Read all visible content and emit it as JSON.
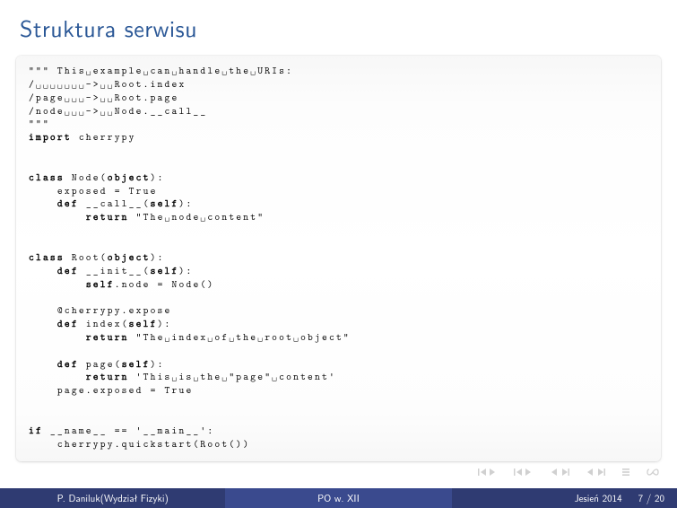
{
  "title": "Struktura serwisu",
  "code": {
    "l01": "\"\"\" This␣example␣can␣handle␣the␣URIs:",
    "l02": "/␣␣␣␣␣␣␣->␣␣Root.index",
    "l03": "/page␣␣␣->␣␣Root.page",
    "l04": "/node␣␣␣->␣␣Node.__call__",
    "l05": "\"\"\"",
    "l06a": "import",
    "l06b": " cherrypy",
    "l07": "",
    "l08": "",
    "l09a": "class",
    "l09b": " Node(",
    "l09c": "object",
    "l09d": "):",
    "l10": "    exposed = True",
    "l11a": "    ",
    "l11b": "def",
    "l11c": " __call__(",
    "l11d": "self",
    "l11e": "):",
    "l12a": "        ",
    "l12b": "return",
    "l12c": " \"The␣node␣content\"",
    "l13": "",
    "l14": "",
    "l15a": "class",
    "l15b": " Root(",
    "l15c": "object",
    "l15d": "):",
    "l16a": "    ",
    "l16b": "def",
    "l16c": " __init__(",
    "l16d": "self",
    "l16e": "):",
    "l17a": "        ",
    "l17b": "self",
    "l17c": ".node = Node()",
    "l18": "",
    "l19": "    @cherrypy.expose",
    "l20a": "    ",
    "l20b": "def",
    "l20c": " index(",
    "l20d": "self",
    "l20e": "):",
    "l21a": "        ",
    "l21b": "return",
    "l21c": " \"The␣index␣of␣the␣root␣object\"",
    "l22": "",
    "l23a": "    ",
    "l23b": "def",
    "l23c": " page(",
    "l23d": "self",
    "l23e": "):",
    "l24a": "        ",
    "l24b": "return",
    "l24c": " 'This␣is␣the␣\"page\"␣content'",
    "l25": "    page.exposed = True",
    "l26": "",
    "l27": "",
    "l28a": "if",
    "l28b": " __name__ == '__main__':",
    "l29": "    cherrypy.quickstart(Root())"
  },
  "footer": {
    "author": "P. Daniluk(Wydział Fizyki)",
    "center": "PO w. XII",
    "date": "Jesień 2014",
    "page": "7 / 20"
  }
}
